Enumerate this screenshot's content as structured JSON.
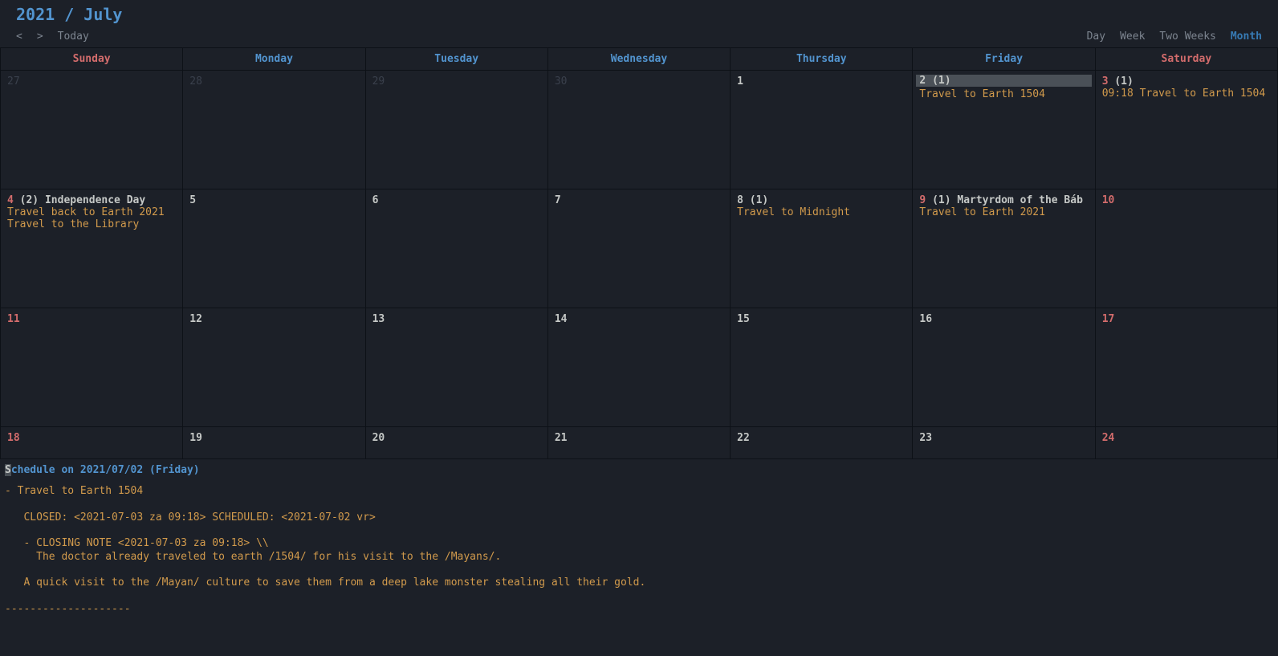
{
  "title": "2021 / July",
  "nav": {
    "prev": "<",
    "next": ">",
    "today": "Today",
    "views": {
      "day": "Day",
      "week": "Week",
      "two_weeks": "Two Weeks",
      "month": "Month"
    }
  },
  "weekdays": {
    "sun": "Sunday",
    "mon": "Monday",
    "tue": "Tuesday",
    "wed": "Wednesday",
    "thu": "Thursday",
    "fri": "Friday",
    "sat": "Saturday"
  },
  "cells": {
    "r0": {
      "sun": {
        "num": "27"
      },
      "mon": {
        "num": "28"
      },
      "tue": {
        "num": "29"
      },
      "wed": {
        "num": "30"
      },
      "thu": {
        "num": "1"
      },
      "fri": {
        "num": "2",
        "count": "(1)",
        "events": [
          "Travel to Earth 1504"
        ]
      },
      "sat": {
        "num": "3",
        "count": "(1)",
        "events": [
          "09:18 Travel to Earth 1504"
        ]
      }
    },
    "r1": {
      "sun": {
        "num": "4",
        "count": "(2)",
        "holiday": "Independence Day",
        "events": [
          "Travel back to Earth 2021",
          "Travel to the Library"
        ]
      },
      "mon": {
        "num": "5"
      },
      "tue": {
        "num": "6"
      },
      "wed": {
        "num": "7"
      },
      "thu": {
        "num": "8",
        "count": "(1)",
        "events": [
          "Travel to Midnight"
        ]
      },
      "fri": {
        "num": "9",
        "count": "(1)",
        "holiday": "Martyrdom of the Báb",
        "events": [
          "Travel to Earth 2021"
        ]
      },
      "sat": {
        "num": "10"
      }
    },
    "r2": {
      "sun": {
        "num": "11"
      },
      "mon": {
        "num": "12"
      },
      "tue": {
        "num": "13"
      },
      "wed": {
        "num": "14"
      },
      "thu": {
        "num": "15"
      },
      "fri": {
        "num": "16"
      },
      "sat": {
        "num": "17"
      }
    },
    "r3": {
      "sun": {
        "num": "18"
      },
      "mon": {
        "num": "19"
      },
      "tue": {
        "num": "20"
      },
      "wed": {
        "num": "21"
      },
      "thu": {
        "num": "22"
      },
      "fri": {
        "num": "23"
      },
      "sat": {
        "num": "24"
      }
    }
  },
  "detail": {
    "title_first": "S",
    "title_rest": "chedule on 2021/07/02 (Friday)",
    "body": "- Travel to Earth 1504\n\n   CLOSED: <2021-07-03 za 09:18> SCHEDULED: <2021-07-02 vr>\n\n   - CLOSING NOTE <2021-07-03 za 09:18> \\\\\n     The doctor already traveled to earth /1504/ for his visit to the /Mayans/.\n\n   A quick visit to the /Mayan/ culture to save them from a deep lake monster stealing all their gold.\n\n--------------------"
  }
}
